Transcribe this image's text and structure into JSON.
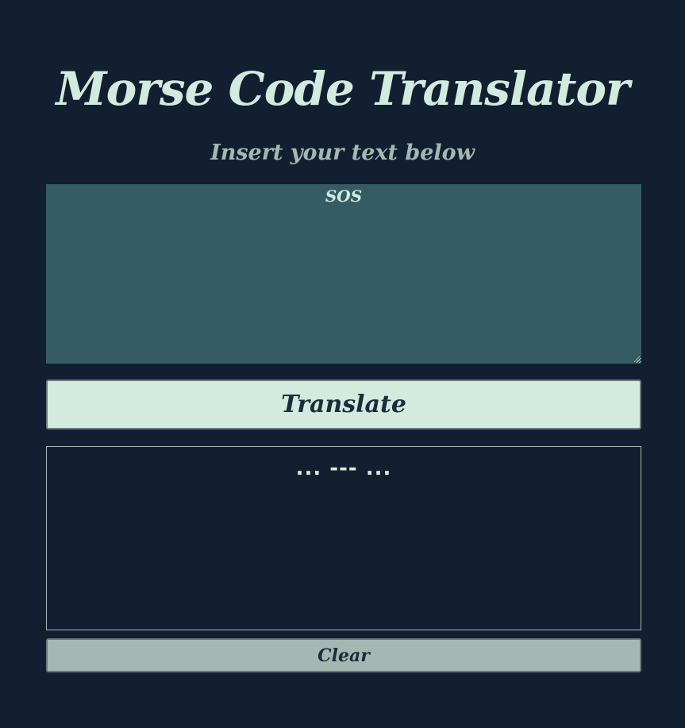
{
  "app": {
    "title": "Morse Code Translator",
    "subtitle": "Insert your text below"
  },
  "input": {
    "value": "SOS",
    "placeholder": ""
  },
  "buttons": {
    "translate_label": "Translate",
    "clear_label": "Clear"
  },
  "output": {
    "text": "... --- ..."
  },
  "colors": {
    "background": "#111f30",
    "accent": "#d3ebde",
    "muted": "#a4b8b3",
    "input_background": "#355c65",
    "button_text": "#1b2c3a"
  }
}
